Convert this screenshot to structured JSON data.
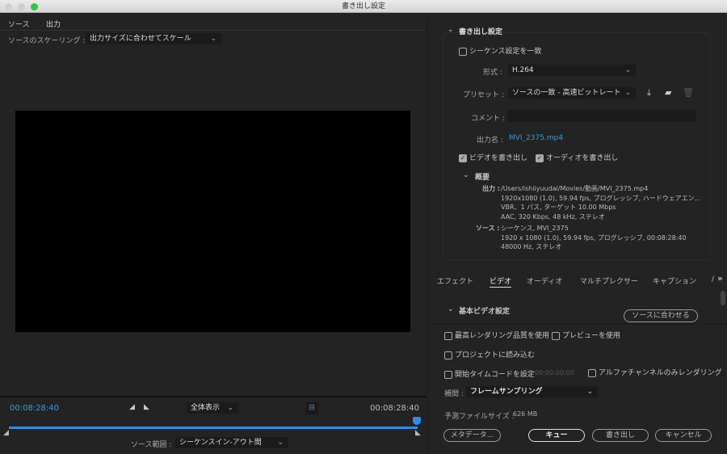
{
  "window": {
    "title": "書き出し設定"
  },
  "left": {
    "tabs": [
      {
        "label": "ソース"
      },
      {
        "label": "出力"
      }
    ],
    "scaling_label": "ソースのスケーリング :",
    "scaling_value": "出力サイズに合わせてスケール",
    "timecode_in": "00:08:28:40",
    "timecode_out": "00:08:28:40",
    "zoom_value": "全体表示",
    "source_range_label": "ソース範囲 :",
    "source_range_value": "シーケンスイン-アウト間",
    "playhead_fraction": 1.0
  },
  "export_settings": {
    "section_title": "書き出し設定",
    "match_sequence": "シーケンス設定を一致",
    "format_label": "形式 :",
    "format_value": "H.264",
    "preset_label": "プリセット :",
    "preset_value": "ソースの一致 - 高速ビットレート",
    "comment_label": "コメント :",
    "comment_value": "",
    "output_name_label": "出力名 :",
    "output_name": "MVI_2375.mp4",
    "export_video": "ビデオを書き出し",
    "export_audio": "オーディオを書き出し",
    "summary_title": "概要",
    "output_label": "出力 :",
    "output_lines": [
      "/Users/ishiiyuudai/Movies/動画/MVI_2375.mp4",
      "1920x1080 (1.0), 59.94 fps, プログレッシブ, ハードウェアエン...",
      "VBR、1 パス, ターゲット 10.00 Mbps",
      "AAC, 320 Kbps, 48 kHz, ステレオ"
    ],
    "source_label": "ソース :",
    "source_lines": [
      "シーケンス, MVI_2375",
      "1920 x 1080 (1.0), 59.94 fps, プログレッシブ, 00:08:28:40",
      "48000 Hz, ステレオ"
    ]
  },
  "tabs": [
    {
      "label": "エフェクト"
    },
    {
      "label": "ビデオ"
    },
    {
      "label": "オーディオ"
    },
    {
      "label": "マルチプレクサー"
    },
    {
      "label": "キャプション"
    },
    {
      "label": "/"
    }
  ],
  "tabs_more": "»",
  "basic_video": {
    "title": "基本ビデオ設定",
    "match_source": "ソースに合わせる"
  },
  "bottom": {
    "max_render": "最高レンダリング品質を使用",
    "use_preview": "プレビューを使用",
    "import_project": "プロジェクトに読み込む",
    "set_timecode": "開始タイムコードを設定",
    "timecode_value": "00:00:00:00",
    "alpha_only": "アルファチャンネルのみレンダリング",
    "interp_label": "補間 :",
    "interp_value": "フレームサンプリング",
    "filesize_label": "予測ファイルサイズ :",
    "filesize_value": "626 MB",
    "metadata": "メタデータ...",
    "queue": "キュー",
    "export": "書き出し",
    "cancel": "キャンセル"
  },
  "colors": {
    "accent": "#2d8ceb",
    "link": "#3a9ad9"
  }
}
